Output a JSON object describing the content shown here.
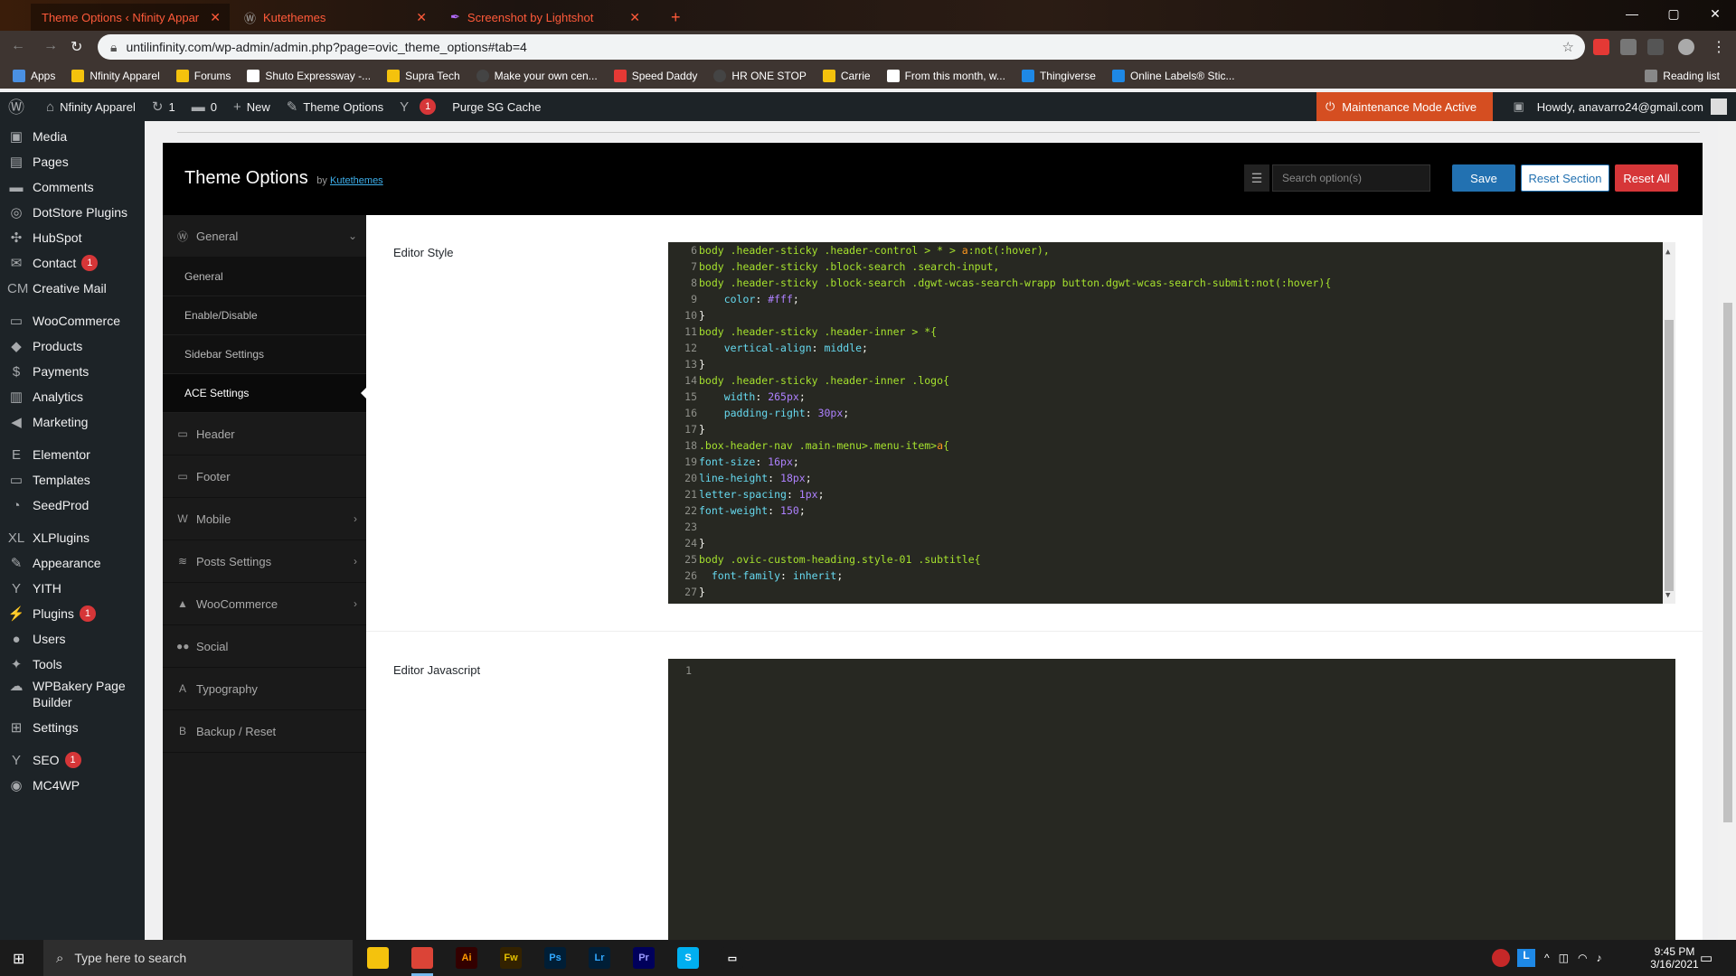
{
  "browser": {
    "tabs": [
      {
        "label": "Theme Options ‹ Nfinity Appar"
      },
      {
        "label": "Kutethemes"
      },
      {
        "label": "Screenshot by Lightshot"
      }
    ],
    "new_tab": "+",
    "window_controls": [
      "—",
      "▢",
      "✕"
    ],
    "url": "untilinfinity.com/wp-admin/admin.php?page=ovic_theme_options#tab=4",
    "bookmarks": [
      {
        "label": "Apps",
        "color": "#4a90e2"
      },
      {
        "label": "Nfinity Apparel",
        "color": "#f4c20d"
      },
      {
        "label": "Forums",
        "color": "#f4c20d"
      },
      {
        "label": "Shuto Expressway -...",
        "color": "#ffffff"
      },
      {
        "label": "Supra Tech",
        "color": "#f4c20d"
      },
      {
        "label": "Make your own cen...",
        "color": "#444"
      },
      {
        "label": "Speed Daddy",
        "color": "#e53935"
      },
      {
        "label": "HR ONE STOP",
        "color": "#444"
      },
      {
        "label": "Carrie",
        "color": "#f4c20d"
      },
      {
        "label": "From this month, w...",
        "color": "#ffffff"
      },
      {
        "label": "Thingiverse",
        "color": "#1e88e5"
      },
      {
        "label": "Online Labels® Stic...",
        "color": "#1e88e5"
      }
    ],
    "reading_list": "Reading list"
  },
  "adminbar": {
    "site": "Nfinity Apparel",
    "updates": "1",
    "comments": "0",
    "new": "New",
    "theme_options": "Theme Options",
    "yoast_badge": "1",
    "purge": "Purge SG Cache",
    "maintenance": "Maintenance Mode Active",
    "howdy": "Howdy, anavarro24@gmail.com"
  },
  "sidebar": {
    "items": [
      {
        "label": "Media",
        "icon": "▣"
      },
      {
        "label": "Pages",
        "icon": "▤"
      },
      {
        "label": "Comments",
        "icon": "▬"
      },
      {
        "label": "DotStore Plugins",
        "icon": "◎"
      },
      {
        "label": "HubSpot",
        "icon": "✣"
      },
      {
        "label": "Contact",
        "icon": "✉",
        "badge": "1"
      },
      {
        "label": "Creative Mail",
        "icon": "CM"
      },
      {
        "label": "WooCommerce",
        "icon": "▭"
      },
      {
        "label": "Products",
        "icon": "◆"
      },
      {
        "label": "Payments",
        "icon": "$"
      },
      {
        "label": "Analytics",
        "icon": "▥"
      },
      {
        "label": "Marketing",
        "icon": "◀"
      },
      {
        "label": "Elementor",
        "icon": "E"
      },
      {
        "label": "Templates",
        "icon": "▭"
      },
      {
        "label": "SeedProd",
        "icon": "◔"
      },
      {
        "label": "XLPlugins",
        "icon": "XL"
      },
      {
        "label": "Appearance",
        "icon": "✎"
      },
      {
        "label": "YITH",
        "icon": "Y"
      },
      {
        "label": "Plugins",
        "icon": "⚡",
        "badge": "1"
      },
      {
        "label": "Users",
        "icon": "●"
      },
      {
        "label": "Tools",
        "icon": "✦"
      },
      {
        "label": "WPBakery Page Builder",
        "icon": "☁"
      },
      {
        "label": "Settings",
        "icon": "⊞"
      },
      {
        "label": "SEO",
        "icon": "Y",
        "badge": "1"
      },
      {
        "label": "MC4WP",
        "icon": "◉"
      }
    ]
  },
  "panel": {
    "title": "Theme Options",
    "by": "by",
    "author": "Kutethemes",
    "search_placeholder": "Search option(s)",
    "save": "Save",
    "reset_section": "Reset Section",
    "reset_all": "Reset All"
  },
  "nav": {
    "general": "General",
    "sub": [
      "General",
      "Enable/Disable",
      "Sidebar Settings",
      "ACE Settings"
    ],
    "items": [
      {
        "label": "Header",
        "icon": "▭"
      },
      {
        "label": "Footer",
        "icon": "▭"
      },
      {
        "label": "Mobile",
        "icon": "W",
        "chevron": true
      },
      {
        "label": "Posts Settings",
        "icon": "≋",
        "chevron": true
      },
      {
        "label": "WooCommerce",
        "icon": "▲",
        "chevron": true
      },
      {
        "label": "Social",
        "icon": "●●"
      },
      {
        "label": "Typography",
        "icon": "A"
      },
      {
        "label": "Backup / Reset",
        "icon": "B"
      }
    ]
  },
  "fields": {
    "editor_style": "Editor Style",
    "editor_js": "Editor Javascript"
  },
  "css_lines": [
    {
      "n": "6",
      "segs": [
        [
          "sel",
          "body .header-sticky .header-control > * > "
        ],
        [
          "kw",
          "a"
        ],
        [
          "sel",
          ":not(:hover),"
        ]
      ]
    },
    {
      "n": "7",
      "segs": [
        [
          "sel",
          "body .header-sticky .block-search .search-input,"
        ]
      ]
    },
    {
      "n": "8",
      "segs": [
        [
          "sel",
          "body .header-sticky .block-search .dgwt-wcas-search-wrapp button.dgwt-wcas-search-submit:not(:hover){"
        ]
      ]
    },
    {
      "n": "9",
      "segs": [
        [
          "plain",
          "    "
        ],
        [
          "prop",
          "color"
        ],
        [
          "plain",
          ": "
        ],
        [
          "num",
          "#fff"
        ],
        [
          "plain",
          ";"
        ]
      ]
    },
    {
      "n": "10",
      "segs": [
        [
          "plain",
          "}"
        ]
      ]
    },
    {
      "n": "11",
      "segs": [
        [
          "sel",
          "body .header-sticky .header-inner > *{"
        ]
      ]
    },
    {
      "n": "12",
      "segs": [
        [
          "plain",
          "    "
        ],
        [
          "prop",
          "vertical-align"
        ],
        [
          "plain",
          ": "
        ],
        [
          "prop",
          "middle"
        ],
        [
          "plain",
          ";"
        ]
      ]
    },
    {
      "n": "13",
      "segs": [
        [
          "plain",
          "}"
        ]
      ]
    },
    {
      "n": "14",
      "segs": [
        [
          "sel",
          "body .header-sticky .header-inner .logo{"
        ]
      ]
    },
    {
      "n": "15",
      "segs": [
        [
          "plain",
          "    "
        ],
        [
          "prop",
          "width"
        ],
        [
          "plain",
          ": "
        ],
        [
          "num",
          "265px"
        ],
        [
          "plain",
          ";"
        ]
      ]
    },
    {
      "n": "16",
      "segs": [
        [
          "plain",
          "    "
        ],
        [
          "prop",
          "padding-right"
        ],
        [
          "plain",
          ": "
        ],
        [
          "num",
          "30px"
        ],
        [
          "plain",
          ";"
        ]
      ]
    },
    {
      "n": "17",
      "segs": [
        [
          "plain",
          "}"
        ]
      ]
    },
    {
      "n": "18",
      "segs": [
        [
          "sel",
          ".box-header-nav .main-menu>.menu-item>"
        ],
        [
          "kw",
          "a"
        ],
        [
          "sel",
          "{"
        ]
      ]
    },
    {
      "n": "19",
      "segs": [
        [
          "prop",
          "font-size"
        ],
        [
          "plain",
          ": "
        ],
        [
          "num",
          "16px"
        ],
        [
          "plain",
          ";"
        ]
      ]
    },
    {
      "n": "20",
      "segs": [
        [
          "prop",
          "line-height"
        ],
        [
          "plain",
          ": "
        ],
        [
          "num",
          "18px"
        ],
        [
          "plain",
          ";"
        ]
      ]
    },
    {
      "n": "21",
      "segs": [
        [
          "prop",
          "letter-spacing"
        ],
        [
          "plain",
          ": "
        ],
        [
          "num",
          "1px"
        ],
        [
          "plain",
          ";"
        ]
      ]
    },
    {
      "n": "22",
      "segs": [
        [
          "prop",
          "font-weight"
        ],
        [
          "plain",
          ": "
        ],
        [
          "num",
          "150"
        ],
        [
          "plain",
          ";"
        ]
      ]
    },
    {
      "n": "23",
      "segs": [
        [
          "plain",
          ""
        ]
      ]
    },
    {
      "n": "24",
      "segs": [
        [
          "plain",
          "}"
        ]
      ]
    },
    {
      "n": "25",
      "segs": [
        [
          "sel",
          "body .ovic-custom-heading.style-01 .subtitle{"
        ]
      ]
    },
    {
      "n": "26",
      "segs": [
        [
          "plain",
          "  "
        ],
        [
          "prop",
          "font-family"
        ],
        [
          "plain",
          ": "
        ],
        [
          "prop",
          "inherit"
        ],
        [
          "plain",
          ";"
        ]
      ]
    },
    {
      "n": "27",
      "segs": [
        [
          "plain",
          "}"
        ]
      ]
    }
  ],
  "js_lines": [
    {
      "n": "1"
    }
  ],
  "taskbar": {
    "search": "Type here to search",
    "apps": [
      {
        "name": "file-explorer",
        "text": "",
        "bg": "#f4c20d",
        "fg": "#333"
      },
      {
        "name": "chrome",
        "text": "",
        "bg": "#db4437",
        "fg": "#fff"
      },
      {
        "name": "illustrator",
        "text": "Ai",
        "bg": "#330000",
        "fg": "#ff9a00"
      },
      {
        "name": "fireworks",
        "text": "Fw",
        "bg": "#332200",
        "fg": "#e6c200"
      },
      {
        "name": "photoshop",
        "text": "Ps",
        "bg": "#001e36",
        "fg": "#31a8ff"
      },
      {
        "name": "lightroom",
        "text": "Lr",
        "bg": "#001e36",
        "fg": "#31a8ff"
      },
      {
        "name": "premiere",
        "text": "Pr",
        "bg": "#00005b",
        "fg": "#9999ff"
      },
      {
        "name": "skype",
        "text": "S",
        "bg": "#00aff0",
        "fg": "#fff"
      },
      {
        "name": "card-app",
        "text": "▭",
        "bg": "#1b1b1b",
        "fg": "#fff"
      }
    ],
    "time": "9:45 PM",
    "date": "3/16/2021"
  }
}
